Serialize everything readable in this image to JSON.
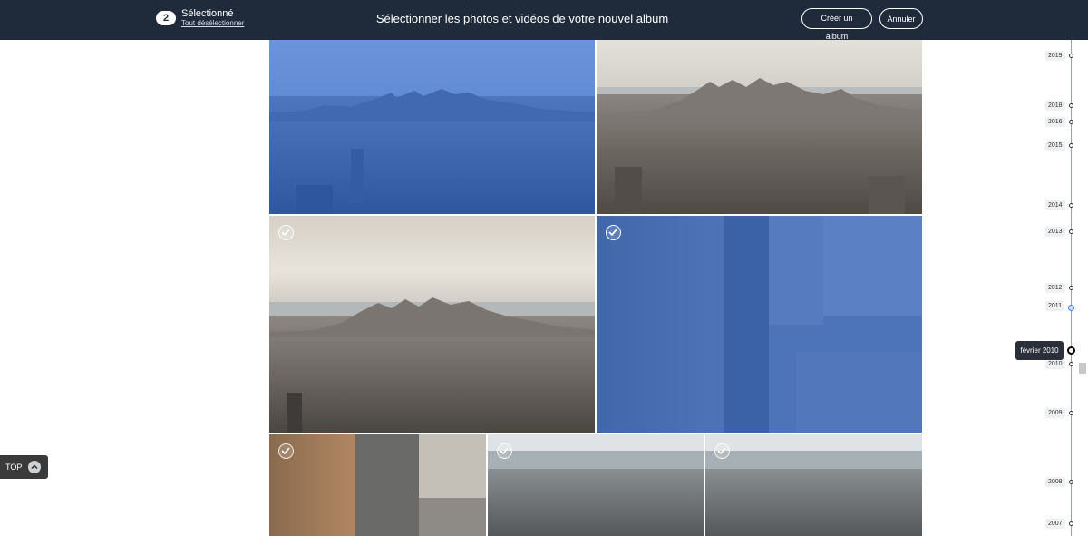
{
  "header": {
    "selected_count": "2",
    "selected_label": "Sélectionné",
    "deselect_all": "Tout désélectionner",
    "title": "Sélectionner les photos et vidéos de votre nouvel album",
    "create_album": "Créer un album",
    "cancel": "Annuler"
  },
  "photos": [
    {
      "id": "a",
      "selected": true,
      "subject": "aerial-city-skyline"
    },
    {
      "id": "b",
      "selected": false,
      "subject": "aerial-city-skyline"
    },
    {
      "id": "c",
      "selected": false,
      "subject": "aerial-city-skyline"
    },
    {
      "id": "d",
      "selected": true,
      "subject": "street-from-above"
    },
    {
      "id": "e",
      "selected": false,
      "subject": "street-from-above"
    },
    {
      "id": "f",
      "selected": false,
      "subject": "city-and-river"
    },
    {
      "id": "g",
      "selected": false,
      "subject": "city-and-river"
    }
  ],
  "timeline": {
    "years": [
      "2019",
      "2018",
      "2016",
      "2015",
      "2014",
      "2013",
      "2012",
      "2011",
      "2010",
      "2009",
      "2008",
      "2007"
    ],
    "active_year": "2011",
    "tooltip": "février 2010"
  },
  "top_button": {
    "label": "TOP",
    "icon": "chevron-up-icon"
  },
  "colors": {
    "header_bg": "#1f2a3a",
    "selection_overlay": "#2666d6"
  }
}
